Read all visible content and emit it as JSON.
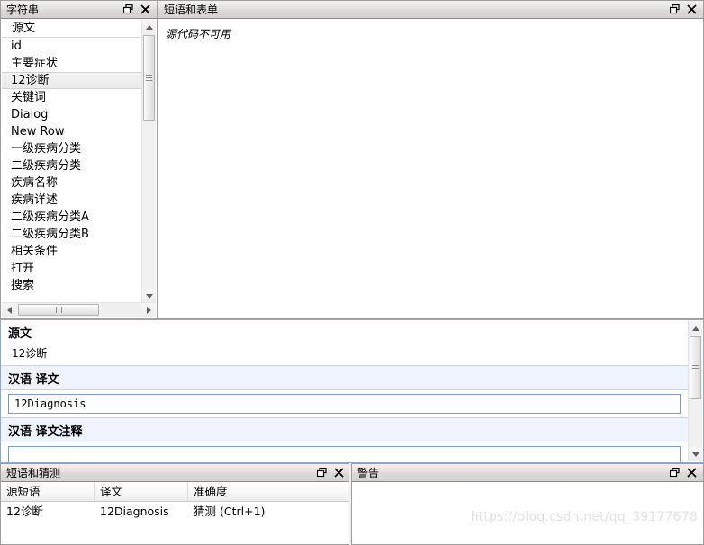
{
  "panels": {
    "strings": {
      "title": "字符串",
      "restore_icon": "restore-icon",
      "close_icon": "close-icon",
      "items": [
        "源文",
        "id",
        "主要症状",
        "12诊断",
        "关键词",
        "Dialog",
        "New Row",
        "一级疾病分类",
        "二级疾病分类",
        "疾病名称",
        "疾病详述",
        "二级疾病分类A",
        "二级疾病分类B",
        "相关条件",
        "打开",
        "搜索"
      ],
      "selected_item": "12诊断",
      "selected_index": 3
    },
    "form": {
      "title": "短语和表单",
      "restore_icon": "restore-icon",
      "close_icon": "close-icon",
      "message": "源代码不可用"
    },
    "editor": {
      "source_label": "源文",
      "source_value": "12诊断",
      "translation_label": "汉语 译文",
      "translation_value": "12Diagnosis",
      "translation_placeholder": "",
      "comment_label": "汉语 译文注释",
      "comment_value": "",
      "comment_placeholder": ""
    },
    "phrases": {
      "title": "短语和猜测",
      "restore_icon": "restore-icon",
      "close_icon": "close-icon",
      "columns": [
        "源短语",
        "译文",
        "准确度"
      ],
      "rows": [
        [
          "12诊断",
          "12Diagnosis",
          "猜测 (Ctrl+1)"
        ]
      ]
    },
    "warnings": {
      "title": "警告",
      "restore_icon": "restore-icon",
      "close_icon": "close-icon",
      "watermark": "https://blog.csdn.net/qq_39177678"
    }
  }
}
